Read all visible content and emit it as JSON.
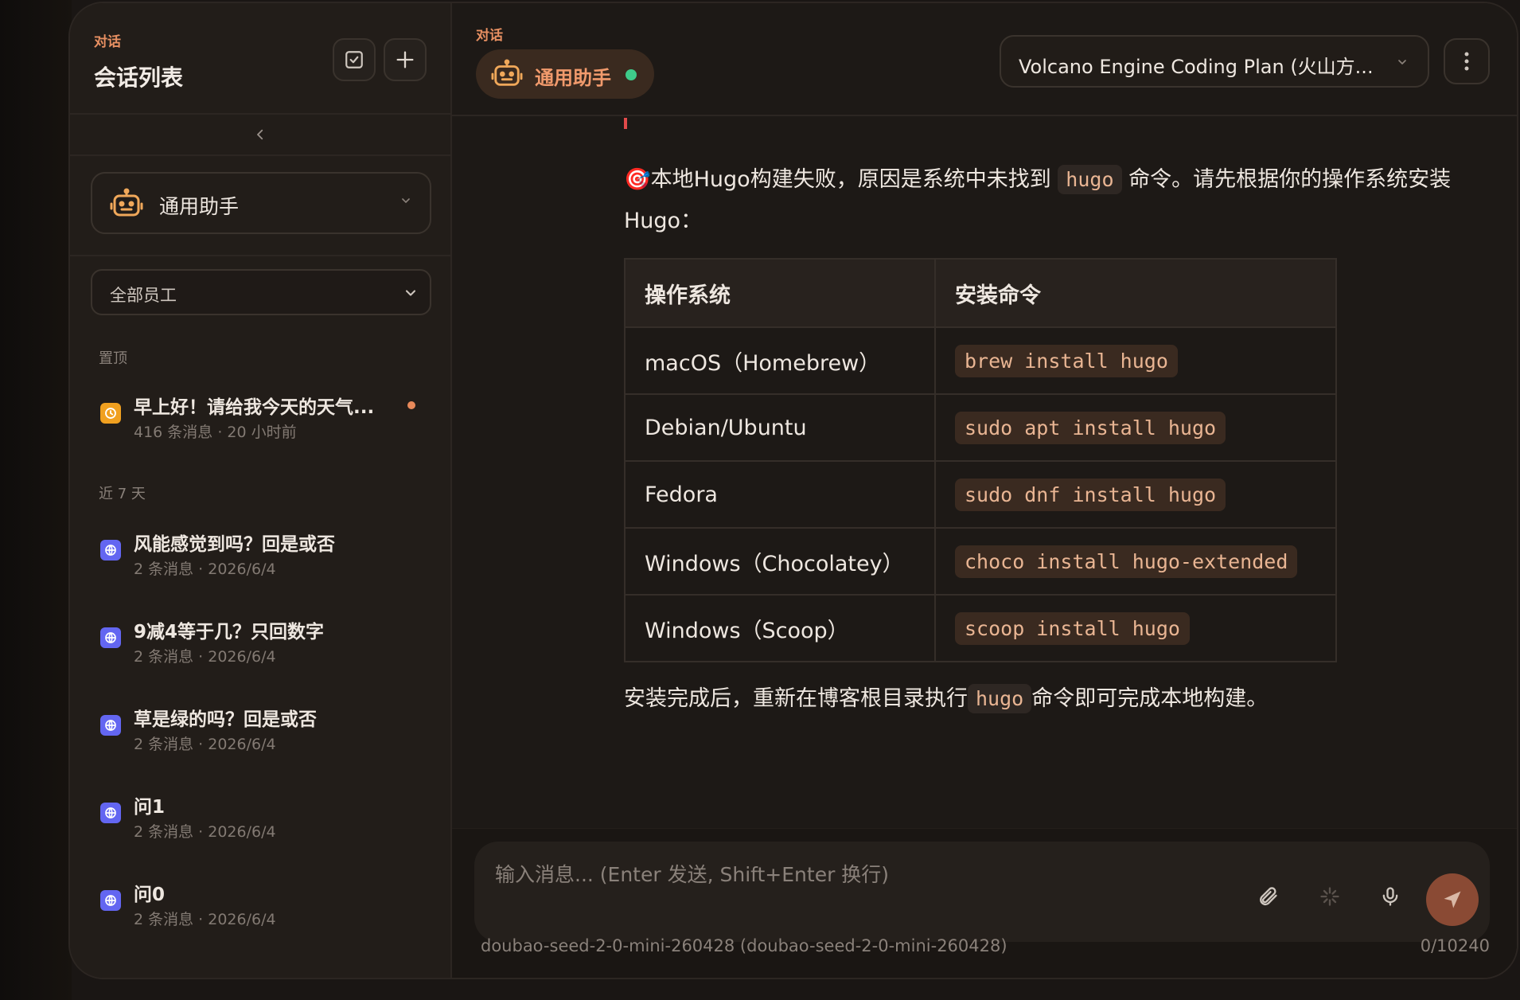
{
  "sidebar": {
    "eyebrow": "对话",
    "title": "会话列表",
    "agent_select": "通用助手",
    "employee_filter": "全部员工",
    "pinned_label": "置顶",
    "recent_label": "近 7 天",
    "pinned": [
      {
        "title": "早上好！请给我今天的天气...",
        "meta": "416 条消息 · 20 小时前"
      }
    ],
    "recent": [
      {
        "title": "风能感觉到吗？回是或否",
        "meta": "2 条消息 · 2026/6/4"
      },
      {
        "title": "9减4等于几？只回数字",
        "meta": "2 条消息 · 2026/6/4"
      },
      {
        "title": "草是绿的吗？回是或否",
        "meta": "2 条消息 · 2026/6/4"
      },
      {
        "title": "问1",
        "meta": "2 条消息 · 2026/6/4"
      },
      {
        "title": "问0",
        "meta": "2 条消息 · 2026/6/4"
      }
    ]
  },
  "header": {
    "eyebrow": "对话",
    "agent_name": "通用助手",
    "model": "Volcano Engine Coding Plan (火山方..."
  },
  "message": {
    "intro_emoji": "🎯",
    "intro_before": "本地Hugo构建失败，原因是系统中未找到",
    "intro_code": "hugo",
    "intro_after": "命令。请先根据你的操作系统安装Hugo：",
    "table_headers": [
      "操作系统",
      "安装命令"
    ],
    "table_rows": [
      {
        "os": "macOS（Homebrew）",
        "cmd": "brew install hugo"
      },
      {
        "os": "Debian/Ubuntu",
        "cmd": "sudo apt install hugo"
      },
      {
        "os": "Fedora",
        "cmd": "sudo dnf install hugo"
      },
      {
        "os": "Windows（Chocolatey）",
        "cmd": "choco install hugo-extended"
      },
      {
        "os": "Windows（Scoop）",
        "cmd": "scoop install hugo"
      }
    ],
    "outro_before": "安装完成后，重新在博客根目录执行",
    "outro_code": "hugo",
    "outro_after": "命令即可完成本地构建。"
  },
  "composer": {
    "placeholder": "输入消息... (Enter 发送, Shift+Enter 换行)",
    "model_footer": "doubao-seed-2-0-mini-260428 (doubao-seed-2-0-mini-260428)",
    "char_count": "0/10240"
  },
  "colors": {
    "accent": "#e8895a",
    "online": "#3ecb8a",
    "send": "#8a4a34"
  }
}
